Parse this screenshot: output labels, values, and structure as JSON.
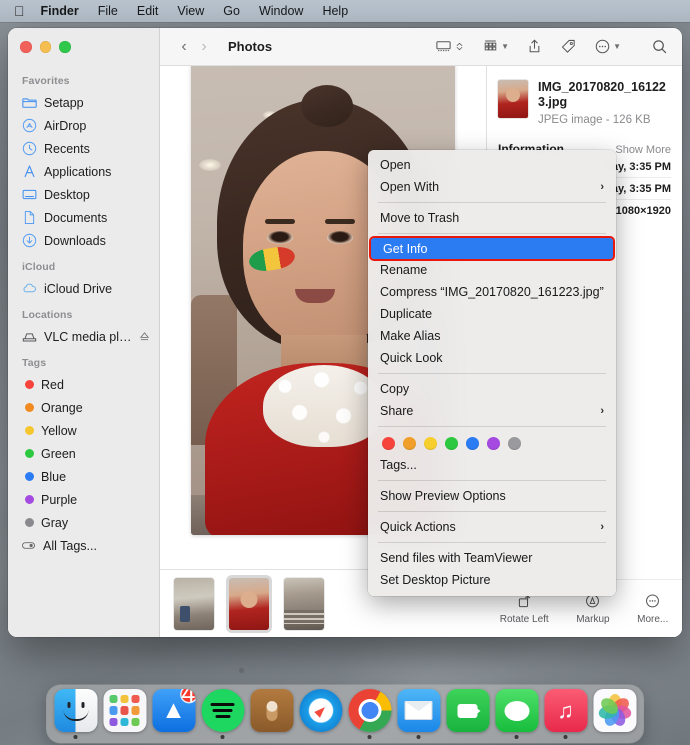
{
  "menubar": {
    "apple_icon": "apple-logo-icon",
    "items": [
      {
        "label": "Finder",
        "bold": true
      },
      {
        "label": "File",
        "bold": false
      },
      {
        "label": "Edit",
        "bold": false
      },
      {
        "label": "View",
        "bold": false
      },
      {
        "label": "Go",
        "bold": false
      },
      {
        "label": "Window",
        "bold": false
      },
      {
        "label": "Help",
        "bold": false
      }
    ]
  },
  "window": {
    "title": "Photos",
    "nav_back_icon": "chevron-left-icon",
    "nav_forward_icon": "chevron-right-icon",
    "traffic_lights": {
      "close": "#f2605a",
      "minimize": "#f6bd4f",
      "maximize": "#2fc84a"
    },
    "toolbar_buttons": [
      {
        "name": "gallery-view",
        "icon": "gallery-view-icon",
        "has_stepper": true
      },
      {
        "name": "group-by",
        "icon": "grid-group-icon",
        "has_chevron": true
      },
      {
        "name": "share",
        "icon": "share-icon",
        "has_chevron": false
      },
      {
        "name": "tag",
        "icon": "tag-icon",
        "has_chevron": false
      },
      {
        "name": "actions",
        "icon": "ellipsis-circle-icon",
        "has_chevron": true
      },
      {
        "name": "search",
        "icon": "search-icon",
        "has_chevron": false
      }
    ]
  },
  "sidebar": {
    "sections": [
      {
        "heading": "Favorites",
        "items": [
          {
            "label": "Setapp",
            "icon": "folder-icon"
          },
          {
            "label": "AirDrop",
            "icon": "airdrop-icon"
          },
          {
            "label": "Recents",
            "icon": "clock-icon"
          },
          {
            "label": "Applications",
            "icon": "applications-icon"
          },
          {
            "label": "Desktop",
            "icon": "desktop-icon"
          },
          {
            "label": "Documents",
            "icon": "document-icon"
          },
          {
            "label": "Downloads",
            "icon": "download-icon"
          }
        ]
      },
      {
        "heading": "iCloud",
        "items": [
          {
            "label": "iCloud Drive",
            "icon": "cloud-icon"
          }
        ]
      },
      {
        "heading": "Locations",
        "items": [
          {
            "label": "VLC media pla...",
            "icon": "disk-icon",
            "eject": true
          }
        ]
      },
      {
        "heading": "Tags",
        "items": [
          {
            "label": "Red",
            "color": "#f6443d"
          },
          {
            "label": "Orange",
            "color": "#f08a21"
          },
          {
            "label": "Yellow",
            "color": "#f6c62e"
          },
          {
            "label": "Green",
            "color": "#2cc940"
          },
          {
            "label": "Blue",
            "color": "#2b7bf3"
          },
          {
            "label": "Purple",
            "color": "#a44ae0"
          },
          {
            "label": "Gray",
            "color": "#8a8a8e"
          },
          {
            "label": "All Tags...",
            "icon": "all-tags-icon"
          }
        ]
      }
    ]
  },
  "info_panel": {
    "filename": "IMG_20170820_161223.jpg",
    "meta": "JPEG image - 126 KB",
    "section_title": "Information",
    "show_more": "Show More",
    "rows": [
      {
        "value": "day, 3:35 PM"
      },
      {
        "value": "day, 3:35 PM"
      },
      {
        "value": "1080×1920"
      }
    ]
  },
  "bottom_actions": [
    {
      "label": "Rotate Left",
      "icon": "rotate-left-icon"
    },
    {
      "label": "Markup",
      "icon": "markup-icon"
    },
    {
      "label": "More...",
      "icon": "more-ellipsis-icon"
    }
  ],
  "context_menu": {
    "highlighted": "Get Info",
    "highlight_color": "#2b7bf3",
    "annotation_border_color": "#e8180c",
    "groups": [
      {
        "items": [
          {
            "label": "Open",
            "submenu": false
          },
          {
            "label": "Open With",
            "submenu": true
          }
        ]
      },
      {
        "items": [
          {
            "label": "Move to Trash",
            "submenu": false
          }
        ]
      },
      {
        "items": [
          {
            "label": "Get Info",
            "submenu": false,
            "highlighted": true
          },
          {
            "label": "Rename",
            "submenu": false
          },
          {
            "label": "Compress “IMG_20170820_161223.jpg”",
            "submenu": false
          },
          {
            "label": "Duplicate",
            "submenu": false
          },
          {
            "label": "Make Alias",
            "submenu": false
          },
          {
            "label": "Quick Look",
            "submenu": false
          }
        ]
      },
      {
        "items": [
          {
            "label": "Copy",
            "submenu": false
          },
          {
            "label": "Share",
            "submenu": true
          }
        ]
      }
    ],
    "tag_colors": [
      "#f6443d",
      "#f0a02a",
      "#f6cf2e",
      "#2cc940",
      "#2b7bf3",
      "#a44ae0",
      "#9a9a9e"
    ],
    "tags_label": "Tags...",
    "after_tags": [
      {
        "label": "Show Preview Options",
        "submenu": false
      },
      {
        "label": "Quick Actions",
        "submenu": true
      },
      {
        "label": "Send files with TeamViewer",
        "submenu": false
      },
      {
        "label": "Set Desktop Picture",
        "submenu": false
      }
    ]
  },
  "gallery": {
    "main_photo_alt": "child-with-face-paint-photo",
    "thumbnails": [
      {
        "name": "thumbnail-1",
        "selected": false
      },
      {
        "name": "thumbnail-2",
        "selected": true
      },
      {
        "name": "thumbnail-3",
        "selected": false
      }
    ]
  },
  "dock": {
    "apps": [
      {
        "name": "finder",
        "running": true,
        "badge": null
      },
      {
        "name": "launchpad",
        "running": false,
        "badge": null
      },
      {
        "name": "app-store",
        "running": false,
        "badge": "4"
      },
      {
        "name": "spotify",
        "running": true,
        "badge": null
      },
      {
        "name": "podcasts",
        "running": false,
        "badge": null
      },
      {
        "name": "safari",
        "running": false,
        "badge": null
      },
      {
        "name": "chrome",
        "running": true,
        "badge": null
      },
      {
        "name": "mail",
        "running": true,
        "badge": null
      },
      {
        "name": "facetime",
        "running": false,
        "badge": null
      },
      {
        "name": "messages",
        "running": true,
        "badge": null
      },
      {
        "name": "music",
        "running": true,
        "badge": null
      },
      {
        "name": "photos",
        "running": false,
        "badge": null
      }
    ]
  }
}
